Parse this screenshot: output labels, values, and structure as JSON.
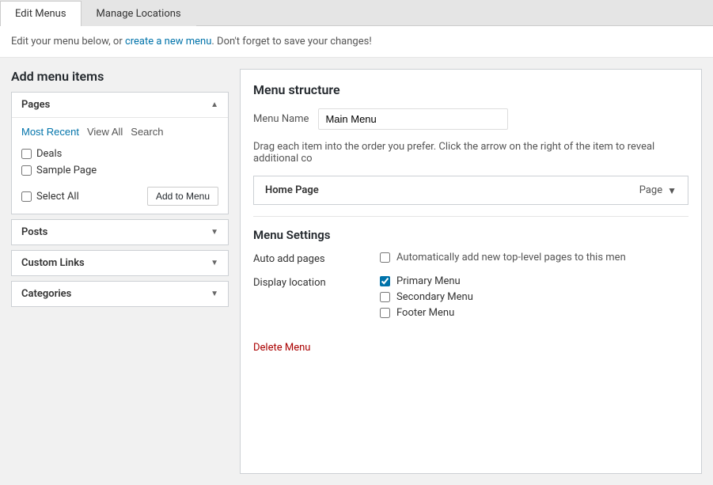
{
  "tabs": [
    {
      "id": "edit-menus",
      "label": "Edit Menus",
      "active": true
    },
    {
      "id": "manage-locations",
      "label": "Manage Locations",
      "active": false
    }
  ],
  "info_bar": {
    "text_before_link": "Edit your menu below, or ",
    "link_text": "create a new menu",
    "text_after_link": ". Don't forget to save your changes!"
  },
  "left_panel": {
    "heading": "Add menu items",
    "pages_section": {
      "label": "Pages",
      "expanded": true,
      "sub_tabs": [
        {
          "id": "most-recent",
          "label": "Most Recent",
          "active": true
        },
        {
          "id": "view-all",
          "label": "View All",
          "active": false
        },
        {
          "id": "search",
          "label": "Search",
          "active": false
        }
      ],
      "pages": [
        {
          "id": "deals",
          "label": "Deals",
          "checked": false
        },
        {
          "id": "sample-page",
          "label": "Sample Page",
          "checked": false
        }
      ],
      "select_all_label": "Select All",
      "add_button_label": "Add to Menu"
    },
    "posts_section": {
      "label": "Posts",
      "expanded": false
    },
    "custom_links_section": {
      "label": "Custom Links",
      "expanded": false
    },
    "categories_section": {
      "label": "Categories",
      "expanded": false
    }
  },
  "right_panel": {
    "heading": "Menu structure",
    "menu_name_label": "Menu Name",
    "menu_name_value": "Main Menu",
    "drag_hint": "Drag each item into the order you prefer. Click the arrow on the right of the item to reveal additional co",
    "menu_item": {
      "label": "Home Page",
      "type": "Page"
    },
    "settings": {
      "heading": "Menu Settings",
      "auto_add_label": "Auto add pages",
      "auto_add_hint": "Automatically add new top-level pages to this men",
      "auto_add_checked": false,
      "display_location_label": "Display location",
      "locations": [
        {
          "id": "primary-menu",
          "label": "Primary Menu",
          "checked": true
        },
        {
          "id": "secondary-menu",
          "label": "Secondary Menu",
          "checked": false
        },
        {
          "id": "footer-menu",
          "label": "Footer Menu",
          "checked": false
        }
      ]
    },
    "delete_menu_label": "Delete Menu"
  }
}
